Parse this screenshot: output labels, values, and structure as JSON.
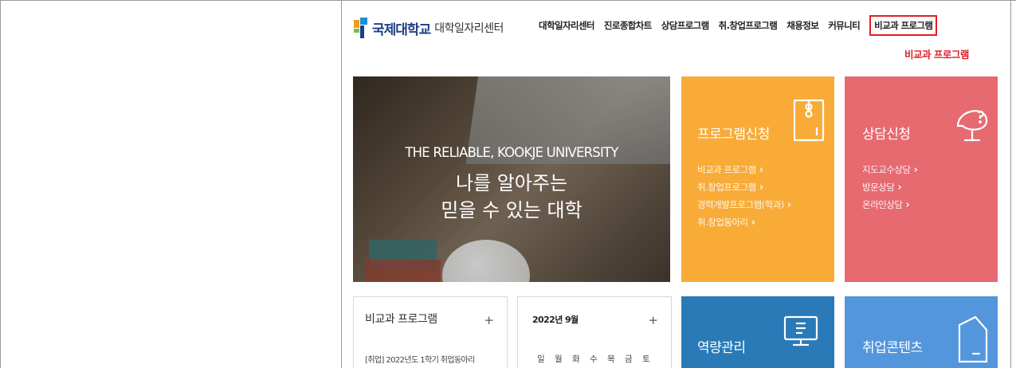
{
  "header": {
    "logo_name": "국제대학교",
    "logo_sub": "대학일자리센터",
    "nav": [
      {
        "label": "대학일자리센터"
      },
      {
        "label": "진로종합차트"
      },
      {
        "label": "상담프로그램"
      },
      {
        "label": "취.창업프로그램"
      },
      {
        "label": "채용정보"
      },
      {
        "label": "커뮤니티"
      },
      {
        "label": "비교과 프로그램"
      }
    ],
    "active_submenu": "비교과 프로그램",
    "active_color": "#e01e26"
  },
  "hero": {
    "en": "THE RELIABLE, KOOKJE UNIVERSITY",
    "line1": "나를 알아주는",
    "line2": "믿을 수 있는 대학"
  },
  "tiles": {
    "program": {
      "title": "프로그램신청",
      "color": "#f8ab37",
      "icon": "file-icon",
      "links": [
        "비교과 프로그램",
        "취.창업프로그램",
        "경력개발프로그램(학과)",
        "취.창업동아리"
      ]
    },
    "counsel": {
      "title": "상담신청",
      "color": "#e76a71",
      "icon": "speech-bubble-icon",
      "links": [
        "지도교수상담",
        "방문상담",
        "온라인상담"
      ]
    },
    "capacity": {
      "title": "역량관리",
      "color": "#2a7ab8",
      "icon": "monitor-icon"
    },
    "content": {
      "title": "취업콘텐츠",
      "color": "#5396dc",
      "icon": "document-icon"
    }
  },
  "noncurricular": {
    "title": "비교과 프로그램",
    "plus": "+",
    "item": "[취업] 2022년도 1학기 취업동아리"
  },
  "calendar": {
    "month": "2022년 9월",
    "plus": "+",
    "weekdays": [
      "일",
      "월",
      "화",
      "수",
      "목",
      "금",
      "토"
    ]
  }
}
